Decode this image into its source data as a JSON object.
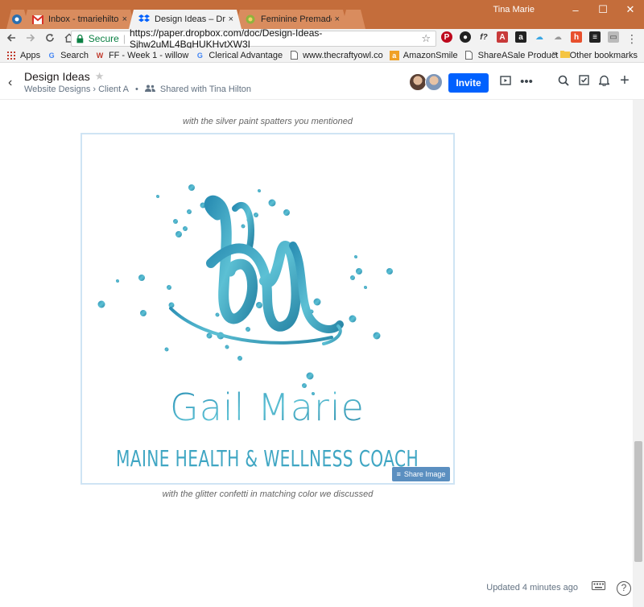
{
  "window": {
    "user": "Tina Marie",
    "minimize": "–",
    "maximize": "☐",
    "close": "✕"
  },
  "tabs": [
    {
      "title": "Inbox - tmariehilton@gm",
      "close": "×"
    },
    {
      "title": "Design Ideas – Dropbox",
      "close": "×"
    },
    {
      "title": "Feminine Premade Logo",
      "close": "×"
    }
  ],
  "toolbar": {
    "secure_label": "Secure",
    "url": "https://paper.dropbox.com/doc/Design-Ideas-Sjhw2uML4BqHUKHvtXW3I",
    "star": "☆"
  },
  "bookmarks": {
    "items": [
      "Apps",
      "Search",
      "FF - Week 1 - willow",
      "Clerical Advantage",
      "www.thecraftyowl.co",
      "AmazonSmile",
      "ShareASale Product D"
    ],
    "more": "»",
    "other": "Other bookmarks"
  },
  "doc": {
    "title": "Design Ideas",
    "breadcrumb": "Website Designs › Client A",
    "dot": "•",
    "shared": "Shared with Tina Hilton",
    "invite": "Invite",
    "caption_top": "with the silver paint spatters you mentioned",
    "caption_bottom": "with the glitter confetti in matching color we discussed",
    "share_image": "Share Image",
    "updated": "Updated 4 minutes ago"
  },
  "logo": {
    "monogram": "GM",
    "name": "Gail Marie",
    "tagline": "MAINE HEALTH & WELLNESS COACH",
    "color": "#3fa6c3"
  },
  "colors": {
    "chrome_frame": "#c46d3b",
    "invite_blue": "#0061fe",
    "logo_teal": "#3fa6c3"
  },
  "icons": [
    "back-icon",
    "forward-icon",
    "reload-icon",
    "home-icon",
    "star-icon",
    "present-icon",
    "more-icon",
    "search-icon",
    "checklist-icon",
    "bell-icon",
    "plus-icon",
    "keyboard-icon",
    "help-icon"
  ]
}
